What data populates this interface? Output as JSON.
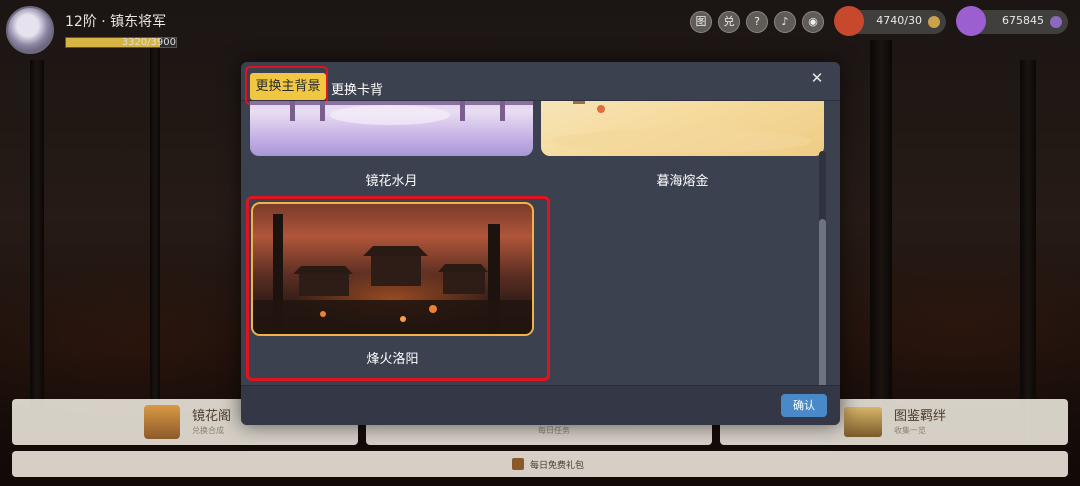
{
  "player": {
    "title": "12阶 · 镇东将军",
    "exp_text": "3320/3900",
    "exp_fraction": 0.851
  },
  "top_icons": [
    "图",
    "兑",
    "?",
    "♪",
    "◉"
  ],
  "currencies": [
    {
      "name": "gold-pouch",
      "value": "4740/30",
      "color": "#c6492d"
    },
    {
      "name": "gem",
      "value": "675845",
      "color": "#9b5fd0"
    }
  ],
  "bottom_cards": [
    {
      "title": "镜花阁",
      "subtitle": "兑换合成"
    },
    {
      "title": "",
      "subtitle": "每日任务"
    },
    {
      "title": "图鉴羁绊",
      "subtitle": "收集一览"
    }
  ],
  "daily_gift": "每日免费礼包",
  "dialog": {
    "tabs": {
      "main": "更换主背景",
      "card": "更换卡背"
    },
    "close": "✕",
    "backgrounds": [
      {
        "name": "镜花水月"
      },
      {
        "name": "暮海熔金"
      },
      {
        "name": "烽火洛阳",
        "selected": true
      }
    ],
    "confirm": "确认"
  }
}
